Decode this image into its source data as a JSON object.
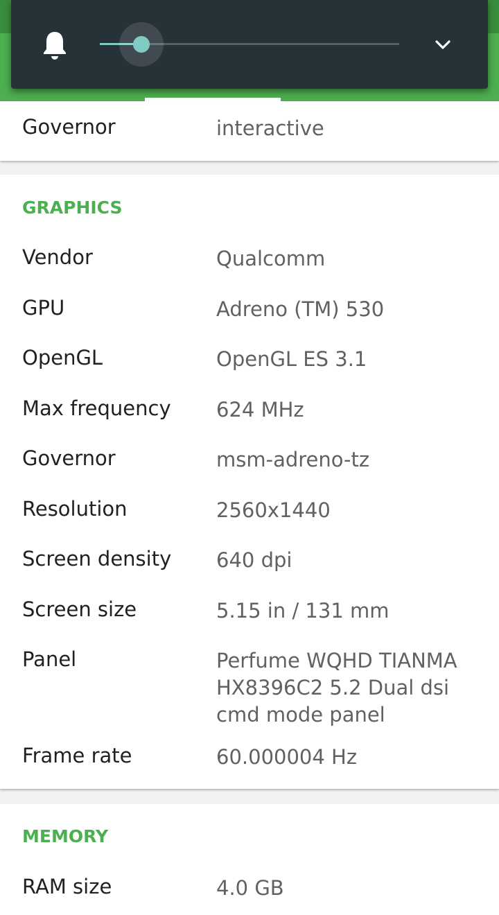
{
  "volume_panel": {
    "icon": "bell-icon",
    "level": 0.14,
    "expand_icon": "chevron-down-icon"
  },
  "colors": {
    "accent": "#4caf50",
    "slider": "#80cbc4",
    "panel": "#263238"
  },
  "cpu": {
    "rows": [
      {
        "label": "Governor",
        "value": "interactive"
      }
    ]
  },
  "graphics": {
    "title": "GRAPHICS",
    "rows": [
      {
        "label": "Vendor",
        "value": "Qualcomm"
      },
      {
        "label": "GPU",
        "value": "Adreno (TM) 530"
      },
      {
        "label": "OpenGL",
        "value": "OpenGL ES 3.1"
      },
      {
        "label": "Max frequency",
        "value": "624 MHz"
      },
      {
        "label": "Governor",
        "value": "msm-adreno-tz"
      },
      {
        "label": "Resolution",
        "value": "2560x1440"
      },
      {
        "label": "Screen density",
        "value": "640 dpi"
      },
      {
        "label": "Screen size",
        "value": "5.15 in / 131 mm"
      },
      {
        "label": "Panel",
        "value": "Perfume WQHD TIANMA HX8396C2 5.2 Dual dsi cmd mode panel"
      },
      {
        "label": "Frame rate",
        "value": "60.000004 Hz"
      }
    ]
  },
  "memory": {
    "title": "MEMORY",
    "rows": [
      {
        "label": "RAM size",
        "value": "4.0 GB"
      }
    ]
  }
}
